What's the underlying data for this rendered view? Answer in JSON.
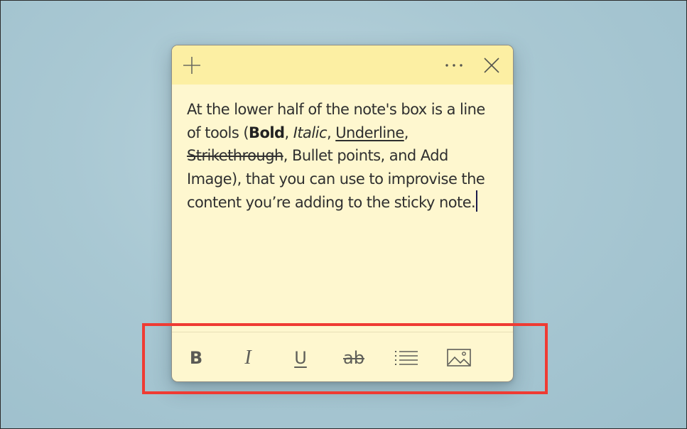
{
  "titlebar": {
    "new_note_icon": "plus-icon",
    "menu_icon": "more-horizontal-icon",
    "close_icon": "close-icon"
  },
  "note": {
    "segments": [
      "At the lower half of the note's box is a line of tools (",
      "Bold",
      ", ",
      "Italic",
      ", ",
      "Underline",
      ", ",
      "Strikethrough",
      ", Bullet points, and Add Image), that you can use to improvise the content you’re adding to the sticky note."
    ]
  },
  "toolbar": {
    "bold_label": "B",
    "italic_label": "I",
    "underline_label": "U",
    "strikethrough_label": "ab",
    "bullets_icon": "bulleted-list-icon",
    "image_icon": "image-icon"
  },
  "colors": {
    "note_body": "#fef7cf",
    "note_titlebar": "#fcefa3",
    "annotation_outline": "#ef3b33"
  }
}
